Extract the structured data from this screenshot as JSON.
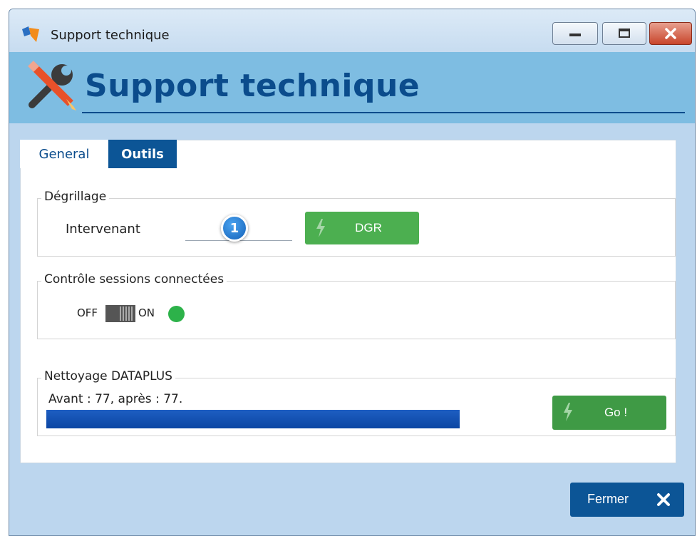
{
  "window": {
    "title": "Support technique"
  },
  "header": {
    "title": "Support technique"
  },
  "tabs": [
    {
      "label": "General",
      "active": false
    },
    {
      "label": "Outils",
      "active": true
    }
  ],
  "degrillage": {
    "group_label": "Dégrillage",
    "field_label": "Intervenant",
    "field_value": "",
    "step_badge": "1",
    "button_label": "DGR"
  },
  "sessions": {
    "group_label": "Contrôle sessions connectées",
    "off_label": "OFF",
    "on_label": "ON",
    "toggle_state": "on",
    "status_color": "#2db24a"
  },
  "nettoyage": {
    "group_label": "Nettoyage DATAPLUS",
    "stats": "Avant : 77, après : 77.",
    "progress_fraction": 1.0,
    "button_label": "Go !"
  },
  "footer": {
    "close_label": "Fermer"
  },
  "colors": {
    "accent_blue": "#0c5596",
    "header_bg": "#7ebde2",
    "button_green": "#4caf50"
  },
  "icons": [
    "app-icon",
    "tools-icon",
    "bolt-icon",
    "close-x-icon",
    "minimize-icon",
    "maximize-icon",
    "window-close-icon"
  ]
}
